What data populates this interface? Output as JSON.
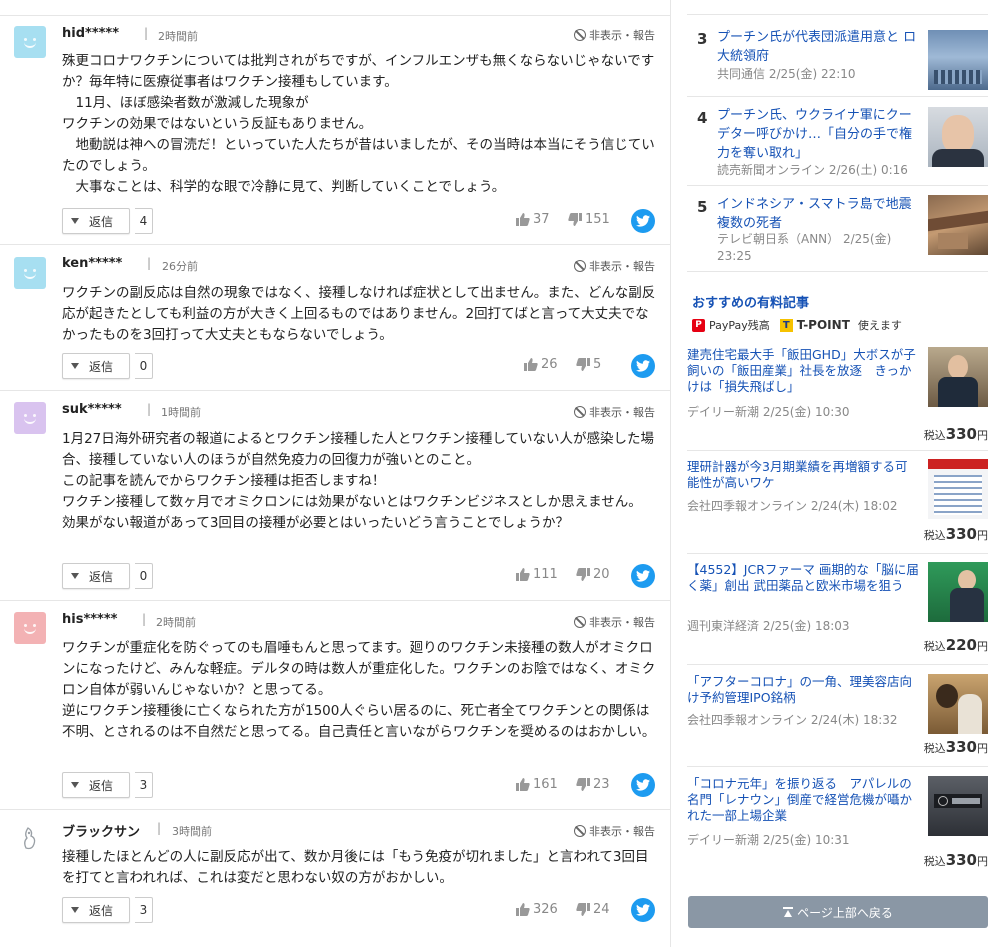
{
  "ui": {
    "hide_report": "非表示・報告",
    "reply_label": "返信"
  },
  "comments": [
    {
      "user": "hid*****",
      "time": "2時間前",
      "avatar_color": "#a7dff1",
      "text": "殊更コロナワクチンについては批判されがちですが、インフルエンザも無くならないじゃないですか？毎年特に医療従事者はワクチン接種もしています。\n　11月、ほぼ感染者数が激減した現象が\nワクチンの効果ではないという反証もありません。\n　地動説は神への冒涜だ！といっていた人たちが昔はいましたが、その当時は本当にそう信じていたのでしょう。\n　大事なことは、科学的な眼で冷静に見て、判断していくことでしょう。",
      "replies": "4",
      "likes": "37",
      "dislikes": "151"
    },
    {
      "user": "ken*****",
      "time": "26分前",
      "avatar_color": "#a7dff1",
      "text": "ワクチンの副反応は自然の現象ではなく、接種しなければ症状として出ません。また、どんな副反応が起きたとしても利益の方が大きく上回るものではありません。2回打てばと言って大丈夫でなかったものを3回打って大丈夫ともならないでしょう。",
      "replies": "0",
      "likes": "26",
      "dislikes": "5"
    },
    {
      "user": "suk*****",
      "time": "1時間前",
      "avatar_color": "#d9c3ef",
      "text": "1月27日海外研究者の報道によるとワクチン接種した人とワクチン接種していない人が感染した場合、接種していない人のほうが自然免疫力の回復力が強いとのこと。\nこの記事を読んでからワクチン接種は拒否しますね！\nワクチン接種して数ヶ月でオミクロンには効果がないとはワクチンビジネスとしか思えません。\n効果がない報道があって3回目の接種が必要とはいったいどう言うことでしょうか？",
      "replies": "0",
      "likes": "111",
      "dislikes": "20"
    },
    {
      "user": "his*****",
      "time": "2時間前",
      "avatar_color": "#f3b2b4",
      "text": "ワクチンが重症化を防ぐってのも眉唾もんと思ってます。廻りのワクチン未接種の数人がオミクロンになったけど、みんな軽症。デルタの時は数人が重症化した。ワクチンのお陰ではなく、オミクロン自体が弱いんじゃないか？と思ってる。\n逆にワクチン接種後に亡くなられた方が1500人ぐらい居るのに、死亡者全てワクチンとの関係は不明、とされるのは不自然だと思ってる。自己責任と言いながらワクチンを奨めるのはおかしい。",
      "replies": "3",
      "likes": "161",
      "dislikes": "23"
    },
    {
      "user": "ブラックサン",
      "time": "3時間前",
      "avatar_color": "#ffffff",
      "text": "接種したほとんどの人に副反応が出て、数か月後には「もう免疫が切れました」と言われて3回目を打てと言われれば、これは変だと思わない奴の方がおかしい。",
      "replies": "3",
      "likes": "326",
      "dislikes": "24"
    }
  ],
  "ranking": [
    {
      "rank": "3",
      "title": "プーチン氏が代表団派遣用意と ロ大統領府",
      "meta": "共同通信 2/25(金) 22:10"
    },
    {
      "rank": "4",
      "title": "プーチン氏、ウクライナ軍にクーデター呼びかけ…「自分の手で権力を奪い取れ」",
      "meta": "読売新聞オンライン 2/26(土) 0:16"
    },
    {
      "rank": "5",
      "title": "インドネシア・スマトラ島で地震 複数の死者",
      "meta": "テレビ朝日系（ANN） 2/25(金) 23:25"
    }
  ],
  "paid": {
    "section_title": "おすすめの有料記事",
    "paypay_label": "PayPay残高",
    "tpoint_label": "T-POINT",
    "usable_label": "使えます",
    "price_prefix": "税込",
    "price_suffix": "円",
    "items": [
      {
        "title": "建売住宅最大手「飯田GHD」大ボスが子飼いの「飯田産業」社長を放逐　きっかけは「損失飛ばし」",
        "meta": "デイリー新潮 2/25(金) 10:30",
        "price": "330"
      },
      {
        "title": "理研計器が今3月期業績を再増額する可能性が高いワケ",
        "meta": "会社四季報オンライン 2/24(木) 18:02",
        "price": "330"
      },
      {
        "title": "【4552】JCRファーマ 画期的な「脳に届く薬」創出 武田薬品と欧米市場を狙う",
        "meta": "週刊東洋経済 2/25(金) 18:03",
        "price": "220"
      },
      {
        "title": "「アフターコロナ」の一角、理美容店向け予約管理IPO銘柄",
        "meta": "会社四季報オンライン 2/24(木) 18:32",
        "price": "330"
      },
      {
        "title": "「コロナ元年」を振り返る　アパレルの名門「レナウン」倒産で経営危機が囁かれた一部上場企業",
        "meta": "デイリー新潮 2/25(金) 10:31",
        "price": "330"
      }
    ]
  },
  "back_to_top": "ページ上部へ戻る",
  "icons": {
    "hide": "hide-icon",
    "like": "thumbs-up-icon",
    "dislike": "thumbs-down-icon",
    "share": "twitter-bird-icon"
  },
  "colors": {
    "link": "#1652b5",
    "twitter": "#1d9bf0",
    "top_button": "#8a97a5"
  }
}
